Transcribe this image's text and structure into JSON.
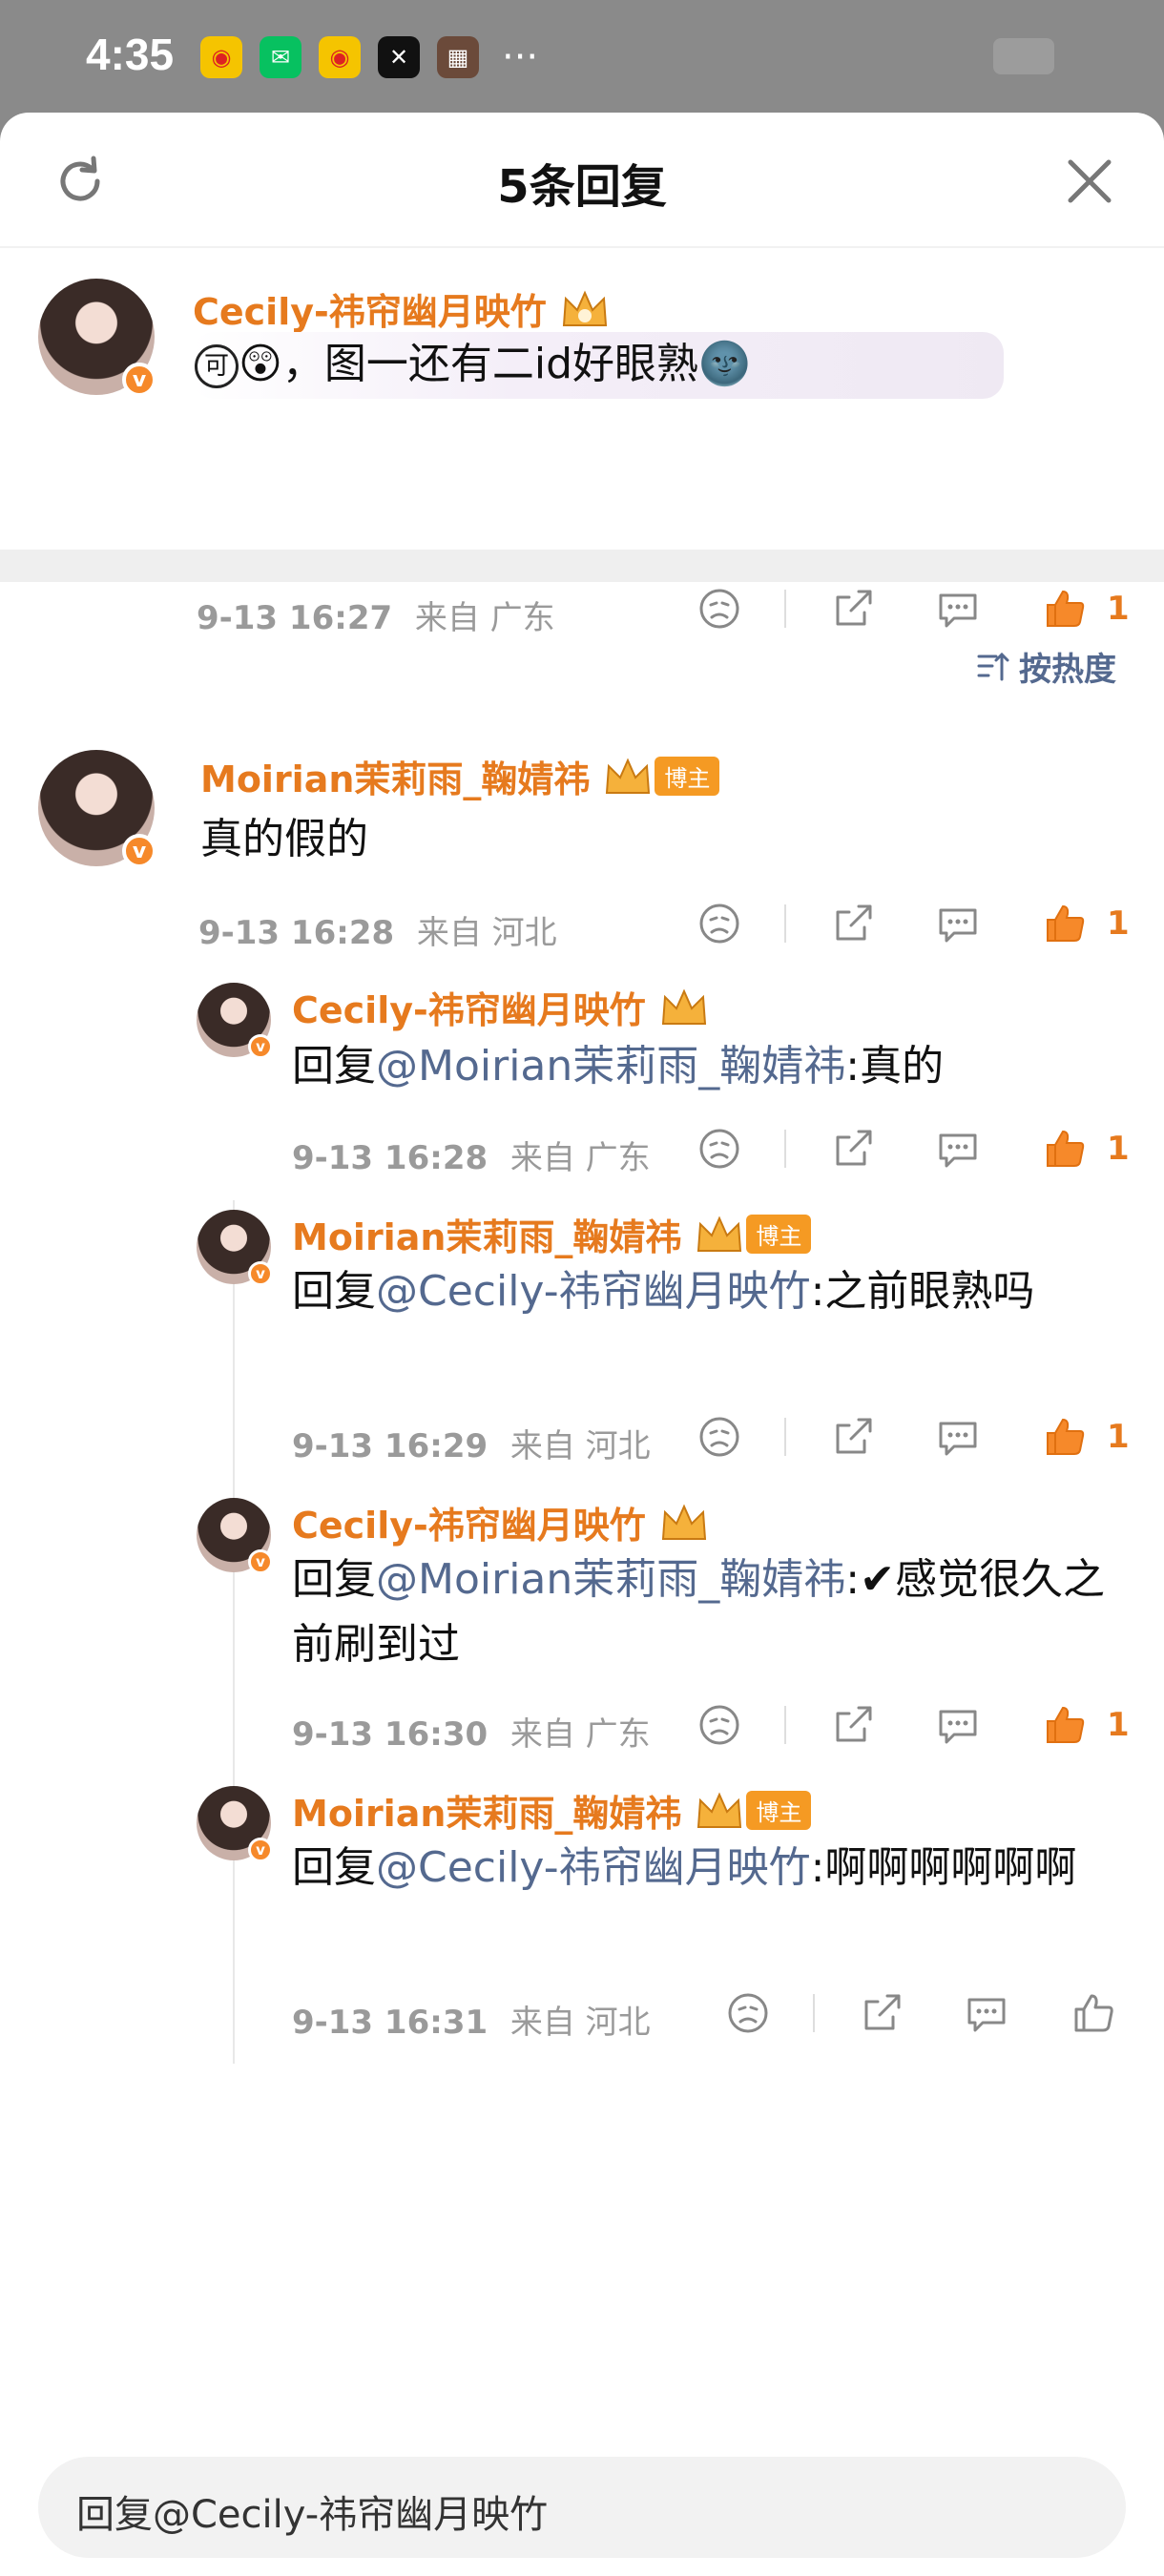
{
  "status_bar": {
    "time": "4:35"
  },
  "header": {
    "title": "5条回复"
  },
  "main_comment": {
    "username": "Cecily-祎帘幽月映竹",
    "text": "😲，图一还有二id好眼熟🌚",
    "prefix": "可",
    "date": "9-13 16:27",
    "location": "来自 广东",
    "likes": "1"
  },
  "sort": {
    "label": "按热度"
  },
  "reply": {
    "username": "Moirian茉莉雨_鞠婧祎",
    "badge": "博主",
    "text": "真的假的",
    "date": "9-13 16:28",
    "location": "来自 河北",
    "likes": "1"
  },
  "sub_replies": [
    {
      "username": "Cecily-祎帘幽月映竹",
      "prefix": "回复",
      "mention": "@Moirian茉莉雨_鞠婧祎",
      "text": ":真的",
      "date": "9-13 16:28",
      "location": "来自 广东",
      "likes": "1"
    },
    {
      "username": "Moirian茉莉雨_鞠婧祎",
      "badge": "博主",
      "prefix": "回复",
      "mention": "@Cecily-祎帘幽月映竹",
      "text": ":之前眼熟吗",
      "date": "9-13 16:29",
      "location": "来自 河北",
      "likes": "1"
    },
    {
      "username": "Cecily-祎帘幽月映竹",
      "prefix": "回复",
      "mention": "@Moirian茉莉雨_鞠婧祎",
      "text": ":✔感觉很久之前刷到过",
      "date": "9-13 16:30",
      "location": "来自 广东",
      "likes": "1"
    },
    {
      "username": "Moirian茉莉雨_鞠婧祎",
      "badge": "博主",
      "prefix": "回复",
      "mention": "@Cecily-祎帘幽月映竹",
      "text": ":啊啊啊啊啊啊",
      "date": "9-13 16:31",
      "location": "来自 河北",
      "likes": ""
    }
  ],
  "input": {
    "placeholder": "回复@Cecily-祎帘幽月映竹"
  },
  "colors": {
    "accent": "#e67a1e",
    "mention": "#54698f",
    "meta": "#9a9a9a"
  }
}
